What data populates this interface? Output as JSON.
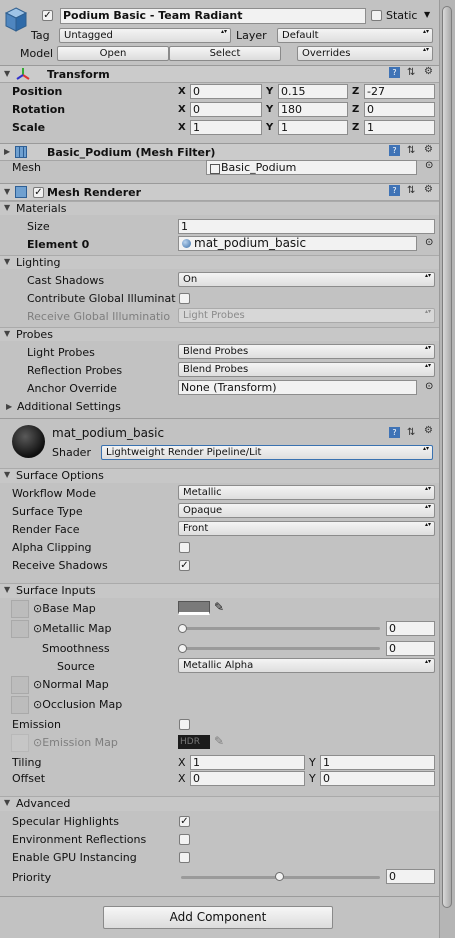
{
  "header": {
    "object_name": "Podium Basic - Team Radiant",
    "static_label": "Static",
    "tag_label": "Tag",
    "tag_value": "Untagged",
    "layer_label": "Layer",
    "layer_value": "Default",
    "model_label": "Model",
    "open": "Open",
    "select": "Select",
    "overrides": "Overrides"
  },
  "transform": {
    "title": "Transform",
    "position": {
      "label": "Position",
      "x": "0",
      "y": "0.15",
      "z": "-27"
    },
    "rotation": {
      "label": "Rotation",
      "x": "0",
      "y": "180",
      "z": "0"
    },
    "scale": {
      "label": "Scale",
      "x": "1",
      "y": "1",
      "z": "1"
    },
    "x": "X",
    "y": "Y",
    "z": "Z"
  },
  "mesh_filter": {
    "title": "Basic_Podium (Mesh Filter)",
    "mesh_label": "Mesh",
    "mesh_value": "Basic_Podium"
  },
  "mesh_renderer": {
    "title": "Mesh Renderer",
    "materials": "Materials",
    "size_label": "Size",
    "size_value": "1",
    "element0_label": "Element 0",
    "element0_value": "mat_podium_basic",
    "lighting": "Lighting",
    "cast_shadows_label": "Cast Shadows",
    "cast_shadows_value": "On",
    "contribute_gi_label": "Contribute Global Illuminat",
    "receive_gi_label": "Receive Global Illuminatio",
    "receive_gi_value": "Light Probes",
    "probes": "Probes",
    "light_probes_label": "Light Probes",
    "light_probes_value": "Blend Probes",
    "reflection_probes_label": "Reflection Probes",
    "reflection_probes_value": "Blend Probes",
    "anchor_label": "Anchor Override",
    "anchor_value": "None (Transform)",
    "additional": "Additional Settings"
  },
  "material": {
    "name": "mat_podium_basic",
    "shader_label": "Shader",
    "shader_value": "Lightweight Render Pipeline/Lit",
    "surface_options": "Surface Options",
    "workflow_label": "Workflow Mode",
    "workflow_value": "Metallic",
    "surface_type_label": "Surface Type",
    "surface_type_value": "Opaque",
    "render_face_label": "Render Face",
    "render_face_value": "Front",
    "alpha_clip_label": "Alpha Clipping",
    "receive_shadows_label": "Receive Shadows",
    "surface_inputs": "Surface Inputs",
    "base_map_label": "Base Map",
    "metallic_map_label": "Metallic Map",
    "metallic_value": "0",
    "smoothness_label": "Smoothness",
    "smoothness_value": "0",
    "source_label": "Source",
    "source_value": "Metallic Alpha",
    "normal_map_label": "Normal Map",
    "occlusion_map_label": "Occlusion Map",
    "emission_label": "Emission",
    "emission_map_label": "Emission Map",
    "hdr": "HDR",
    "tiling_label": "Tiling",
    "tiling_x": "1",
    "tiling_y": "1",
    "offset_label": "Offset",
    "offset_x": "0",
    "offset_y": "0",
    "advanced": "Advanced",
    "specular_label": "Specular Highlights",
    "env_refl_label": "Environment Reflections",
    "gpu_inst_label": "Enable GPU Instancing",
    "priority_label": "Priority",
    "priority_value": "0"
  },
  "add_component": "Add Component",
  "colors": {
    "accent": "#3a72b0",
    "panel": "#c2c2c2",
    "header": "#cbcbcb"
  }
}
